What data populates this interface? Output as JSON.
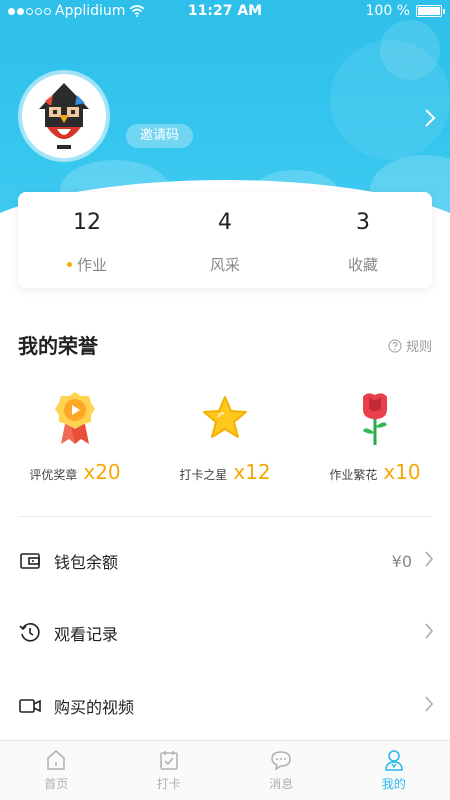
{
  "status_bar": {
    "carrier": "Applidium",
    "time": "11:27 AM",
    "battery": "100 %"
  },
  "profile": {
    "invite_label": "邀请码"
  },
  "stats": [
    {
      "value": "12",
      "label": "作业"
    },
    {
      "value": "4",
      "label": "风采"
    },
    {
      "value": "3",
      "label": "收藏"
    }
  ],
  "honors": {
    "title": "我的荣誉",
    "rules_label": "规则",
    "items": [
      {
        "name": "评优奖章",
        "count": "x20",
        "icon": "medal-icon"
      },
      {
        "name": "打卡之星",
        "count": "x12",
        "icon": "star-icon"
      },
      {
        "name": "作业繁花",
        "count": "x10",
        "icon": "rose-icon"
      }
    ]
  },
  "menu": [
    {
      "label": "钱包余额",
      "value": "¥0",
      "icon": "wallet-icon"
    },
    {
      "label": "观看记录",
      "value": "",
      "icon": "history-icon"
    },
    {
      "label": "购买的视频",
      "value": "",
      "icon": "video-icon"
    }
  ],
  "tabs": [
    {
      "label": "首页",
      "icon": "home-icon",
      "active": false
    },
    {
      "label": "打卡",
      "icon": "calendar-check-icon",
      "active": false
    },
    {
      "label": "消息",
      "icon": "message-icon",
      "active": false
    },
    {
      "label": "我的",
      "icon": "user-icon",
      "active": true
    }
  ],
  "colors": {
    "header": "#35c5ee",
    "accent_orange": "#f5a800",
    "active_tab": "#2db8e8"
  }
}
